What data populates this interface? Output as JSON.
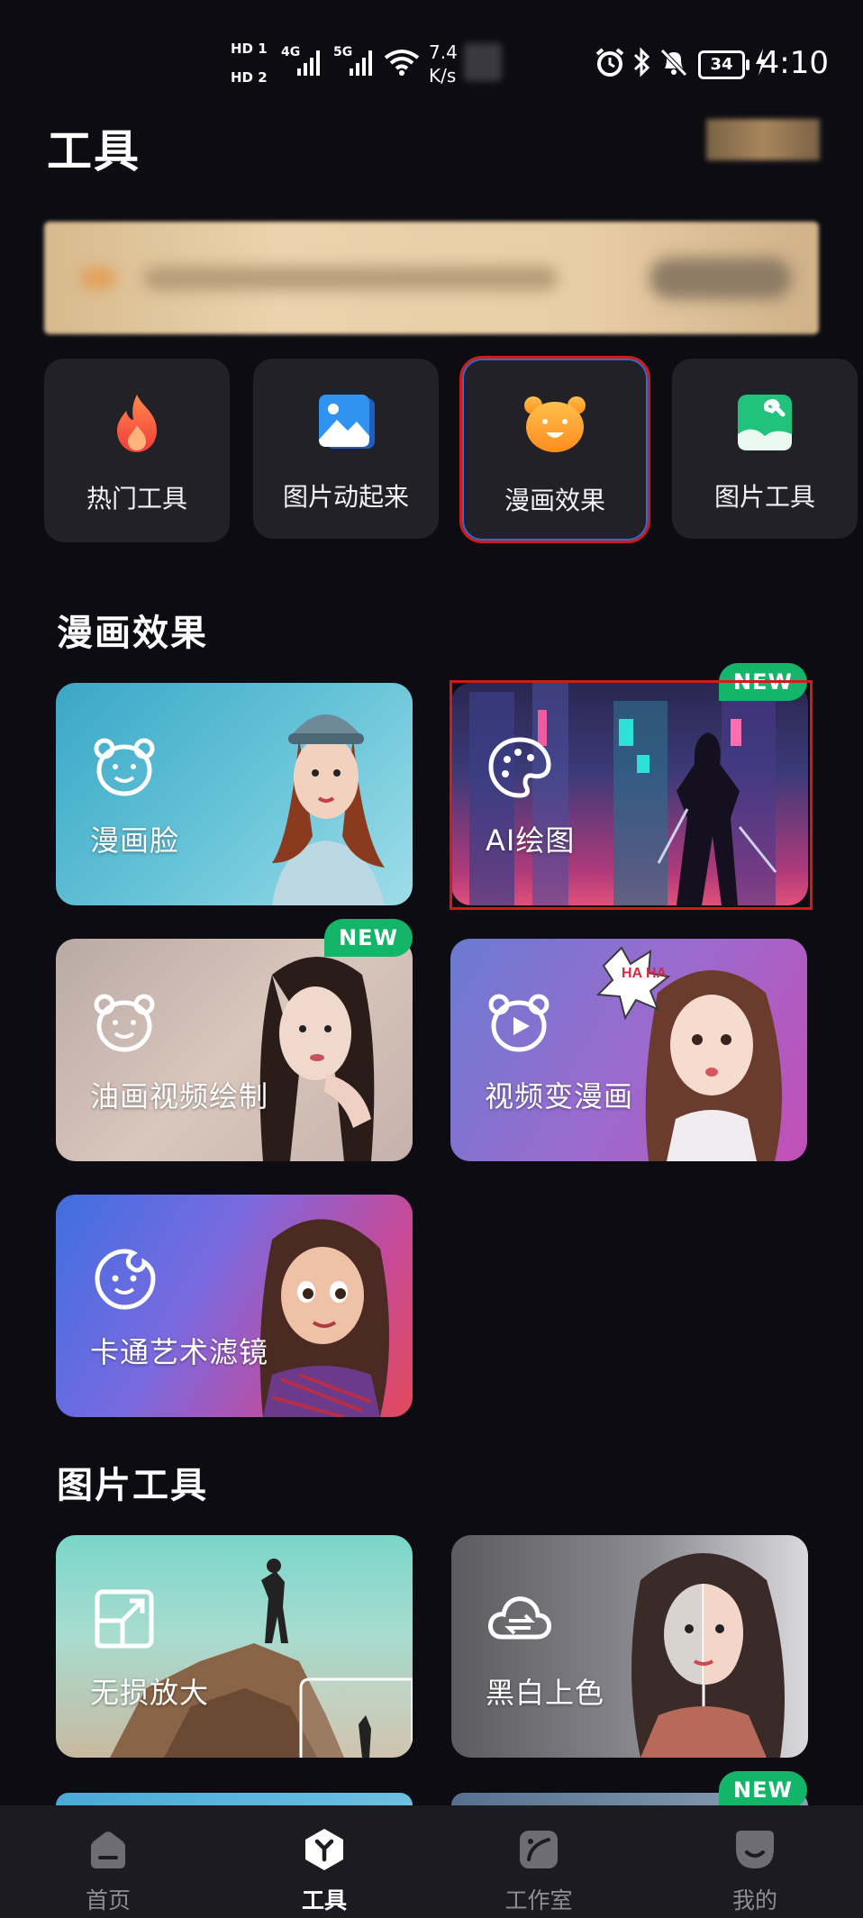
{
  "status_bar": {
    "hd1": "HD 1",
    "hd2": "HD 2",
    "net1": "4G",
    "net2": "5G",
    "speed_value": "7.4",
    "speed_unit": "K/s",
    "battery": "34",
    "time": "4:10"
  },
  "header": {
    "title": "工具"
  },
  "categories": [
    {
      "label": "热门工具",
      "icon": "flame-icon",
      "selected": false
    },
    {
      "label": "图片动起来",
      "icon": "animated-image-icon",
      "selected": false
    },
    {
      "label": "漫画效果",
      "icon": "bear-face-icon",
      "selected": true
    },
    {
      "label": "图片工具",
      "icon": "image-wrench-icon",
      "selected": false
    }
  ],
  "sections": {
    "comic": {
      "title": "漫画效果",
      "cards": [
        {
          "label": "漫画脸",
          "icon": "bear-outline-icon",
          "badge": ""
        },
        {
          "label": "AI绘图",
          "icon": "palette-icon",
          "badge": "NEW"
        },
        {
          "label": "油画视频绘制",
          "icon": "bear-outline-icon",
          "badge": "NEW"
        },
        {
          "label": "视频变漫画",
          "icon": "bear-play-icon",
          "badge": "",
          "bubble": "HA HA"
        },
        {
          "label": "卡通艺术滤镜",
          "icon": "cartoon-face-icon",
          "badge": ""
        }
      ]
    },
    "image_tools": {
      "title": "图片工具",
      "cards": [
        {
          "label": "无损放大",
          "icon": "expand-icon",
          "badge": ""
        },
        {
          "label": "黑白上色",
          "icon": "cloud-swap-icon",
          "badge": ""
        }
      ],
      "partial_badge": "NEW"
    }
  },
  "bottom_nav": [
    {
      "label": "首页",
      "icon": "home-icon",
      "active": false
    },
    {
      "label": "工具",
      "icon": "tools-cube-icon",
      "active": true
    },
    {
      "label": "工作室",
      "icon": "studio-icon",
      "active": false
    },
    {
      "label": "我的",
      "icon": "profile-icon",
      "active": false
    }
  ],
  "colors": {
    "background": "#0d0c12",
    "card_bg": "#222127",
    "badge_green": "#13b569",
    "highlight_red": "#d11a1a",
    "nav_bg": "#1c1b21"
  }
}
